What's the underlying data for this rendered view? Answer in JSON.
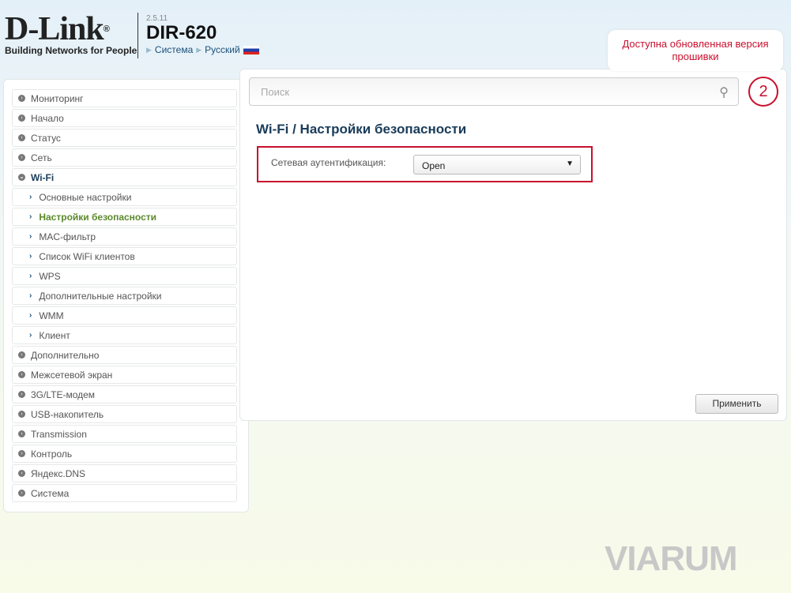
{
  "header": {
    "brand": "D-Link",
    "tagline": "Building Networks for People",
    "version": "2.5.11",
    "model": "DIR-620",
    "crumbs": [
      "Система",
      "Русский"
    ]
  },
  "notification": {
    "text": "Доступна обновленная версия прошивки",
    "count": "2"
  },
  "search": {
    "placeholder": "Поиск"
  },
  "sidebar": {
    "items": [
      {
        "label": "Мониторинг",
        "type": "top"
      },
      {
        "label": "Начало",
        "type": "top"
      },
      {
        "label": "Статус",
        "type": "top"
      },
      {
        "label": "Сеть",
        "type": "top"
      },
      {
        "label": "Wi-Fi",
        "type": "open"
      },
      {
        "label": "Основные настройки",
        "type": "sub"
      },
      {
        "label": "Настройки безопасности",
        "type": "active"
      },
      {
        "label": "MAC-фильтр",
        "type": "sub"
      },
      {
        "label": "Список WiFi клиентов",
        "type": "sub"
      },
      {
        "label": "WPS",
        "type": "sub"
      },
      {
        "label": "Дополнительные настройки",
        "type": "sub"
      },
      {
        "label": "WMM",
        "type": "sub"
      },
      {
        "label": "Клиент",
        "type": "sub"
      },
      {
        "label": "Дополнительно",
        "type": "top"
      },
      {
        "label": "Межсетевой экран",
        "type": "top"
      },
      {
        "label": "3G/LTE-модем",
        "type": "top"
      },
      {
        "label": "USB-накопитель",
        "type": "top"
      },
      {
        "label": "Transmission",
        "type": "top"
      },
      {
        "label": "Контроль",
        "type": "top"
      },
      {
        "label": "Яндекс.DNS",
        "type": "top"
      },
      {
        "label": "Система",
        "type": "top"
      }
    ]
  },
  "main": {
    "title": "Wi-Fi /  Настройки безопасности",
    "auth_label": "Сетевая аутентификация:",
    "auth_value": "Open",
    "apply": "Применить"
  },
  "watermark": "VIARUM"
}
